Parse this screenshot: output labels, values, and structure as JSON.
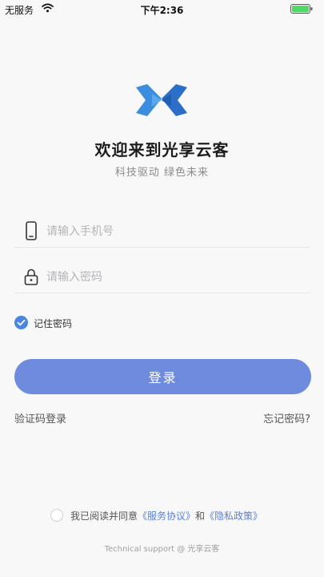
{
  "status_bar": {
    "carrier": "无服务",
    "time": "下午2:36"
  },
  "brand": {
    "logo_icon": "vscode-style-bowtie-logo",
    "title": "欢迎来到光享云客",
    "subtitle": "科技驱动 绿色未来",
    "accent_color": "#6f8bde",
    "logo_color": "#3b8de0"
  },
  "form": {
    "phone": {
      "value": "",
      "placeholder": "请输入手机号",
      "icon": "phone-icon"
    },
    "password": {
      "value": "",
      "placeholder": "请输入密码",
      "icon": "lock-icon"
    },
    "remember_label": "记住密码",
    "remember_checked": true,
    "login_label": "登录"
  },
  "links": {
    "sms_login": "验证码登录",
    "forgot_password": "忘记密码?"
  },
  "agreement": {
    "prefix": "我已阅读并同意",
    "service": "《服务协议》",
    "and": "和",
    "privacy": "《隐私政策》",
    "checked": false
  },
  "footer": {
    "support": "Technical support @ 光享云客"
  }
}
